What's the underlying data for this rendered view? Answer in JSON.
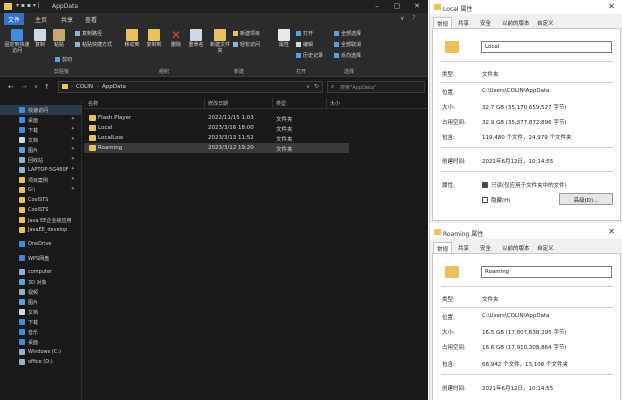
{
  "explorer": {
    "title": "AppData",
    "tabs": [
      "文件",
      "主页",
      "共享",
      "查看"
    ],
    "ribbon": {
      "pin_label": "固定到快速访问",
      "copy_label": "复制",
      "paste_label": "粘贴",
      "copy_path": "复制路径",
      "paste_shortcut": "粘贴快捷方式",
      "cut": "剪切",
      "move_to": "移动到",
      "copy_to": "复制到",
      "delete": "删除",
      "rename": "重命名",
      "new_folder": "新建文件夹",
      "new_item": "新建项目",
      "easy_access": "轻松访问",
      "properties": "属性",
      "open": "打开",
      "edit": "编辑",
      "history": "历史记录",
      "select_all": "全部选择",
      "select_none": "全部取消",
      "invert_select": "反向选择",
      "groups": [
        "剪贴板",
        "组织",
        "新建",
        "打开",
        "选择"
      ]
    },
    "address": {
      "crumbs": [
        "COLIN",
        "AppData"
      ],
      "search_placeholder": "搜索\"AppData\""
    },
    "nav": {
      "items": [
        {
          "label": "快速访问",
          "icon": "star-icon",
          "color": "#3d8ee0",
          "pinned": false,
          "selected": true
        },
        {
          "label": "桌面",
          "icon": "desktop-icon",
          "color": "#3d8ee0",
          "pinned": true
        },
        {
          "label": "下载",
          "icon": "download-icon",
          "color": "#3d8ee0",
          "pinned": true
        },
        {
          "label": "文档",
          "icon": "document-icon",
          "color": "#cfd8e3",
          "pinned": true
        },
        {
          "label": "图片",
          "icon": "picture-icon",
          "color": "#5aa0e0",
          "pinned": true
        },
        {
          "label": "回收站",
          "icon": "recycle-bin-icon",
          "color": "#9ab0c8",
          "pinned": true
        },
        {
          "label": "LAPTOP-5G480F",
          "icon": "computer-icon",
          "color": "#8fb3d8",
          "pinned": true
        },
        {
          "label": "项目案例",
          "icon": "folder-icon",
          "color": "#e8c25a",
          "pinned": true
        },
        {
          "label": "G:\\",
          "icon": "folder-icon",
          "color": "#e8c25a",
          "pinned": true
        },
        {
          "label": "CoolSTS",
          "icon": "folder-icon",
          "color": "#e8c25a",
          "pinned": false
        },
        {
          "label": "CoolSTS",
          "icon": "folder-icon",
          "color": "#e8c25a",
          "pinned": false
        },
        {
          "label": "Java EE企业级应用",
          "icon": "folder-icon",
          "color": "#e8c25a",
          "pinned": false
        },
        {
          "label": "JavaEE_develop",
          "icon": "folder-icon",
          "color": "#e8c25a",
          "pinned": false
        },
        {
          "label": "OneDrive",
          "icon": "cloud-icon",
          "color": "#3d8ee0",
          "pinned": false
        },
        {
          "label": "WPS网盘",
          "icon": "cloud-icon",
          "color": "#4d7fe0",
          "pinned": false
        },
        {
          "label": "computer",
          "icon": "computer-icon",
          "color": "#8fb3d8",
          "pinned": false
        },
        {
          "label": "3D 对象",
          "icon": "cube-icon",
          "color": "#5aa0e0",
          "pinned": false
        },
        {
          "label": "视频",
          "icon": "video-icon",
          "color": "#9ab0c8",
          "pinned": false
        },
        {
          "label": "图片",
          "icon": "picture-icon",
          "color": "#5aa0e0",
          "pinned": false
        },
        {
          "label": "文档",
          "icon": "document-icon",
          "color": "#cfd8e3",
          "pinned": false
        },
        {
          "label": "下载",
          "icon": "download-icon",
          "color": "#3d8ee0",
          "pinned": false
        },
        {
          "label": "音乐",
          "icon": "music-icon",
          "color": "#3d8ee0",
          "pinned": false
        },
        {
          "label": "桌面",
          "icon": "desktop-icon",
          "color": "#3d8ee0",
          "pinned": false
        },
        {
          "label": "Windows (C:)",
          "icon": "drive-icon",
          "color": "#9ab0c8",
          "pinned": false
        },
        {
          "label": "office (D:)",
          "icon": "drive-icon",
          "color": "#9ab0c8",
          "pinned": false
        }
      ]
    },
    "columns": [
      "名称",
      "修改日期",
      "类型",
      "大小"
    ],
    "files": [
      {
        "name": "Flash Player",
        "date": "2022/11/15 1:03",
        "type": "文件夹",
        "size": ""
      },
      {
        "name": "Local",
        "date": "2023/3/16 18:00",
        "type": "文件夹",
        "size": ""
      },
      {
        "name": "LocalLow",
        "date": "2023/3/13 11:52",
        "type": "文件夹",
        "size": ""
      },
      {
        "name": "Roaming",
        "date": "2023/3/12 19:20",
        "type": "文件夹",
        "size": ""
      }
    ]
  },
  "props_local": {
    "title": "Local 属性",
    "tabs": [
      "常规",
      "共享",
      "安全",
      "以前的版本",
      "自定义"
    ],
    "name": "Local",
    "labels": [
      "类型:",
      "位置:",
      "大小:",
      "占用空间:",
      "包含:",
      "创建时间:",
      "属性:"
    ],
    "type": "文件夹",
    "location": "C:\\Users\\COLIN\\AppData",
    "size": "32.7 GB (35,170,659,527 字节)",
    "disk_size": "32.9 GB (35,377,872,896 字节)",
    "contains": "119,480 个文件，24,979 个文件夹",
    "created": "2021年6月12日，10:14:55",
    "readonly_label": "只读(仅应用于文件夹中的文件)",
    "hidden_label": "隐藏(H)",
    "advanced_label": "高级(D)...",
    "readonly_checked": true,
    "hidden_checked": false
  },
  "props_roaming": {
    "title": "Roaming 属性",
    "tabs": [
      "常规",
      "共享",
      "安全",
      "以前的版本",
      "自定义"
    ],
    "name": "Roaming",
    "labels": [
      "类型:",
      "位置:",
      "大小:",
      "占用空间:",
      "包含:",
      "创建时间:"
    ],
    "type": "文件夹",
    "location": "C:\\Users\\COLIN\\AppData",
    "size": "16.5 GB (17,807,638,295 字节)",
    "disk_size": "16.6 GB (17,910,308,864 字节)",
    "contains": "68,942 个文件，13,108 个文件夹",
    "created": "2021年6月12日，10:14:55"
  }
}
